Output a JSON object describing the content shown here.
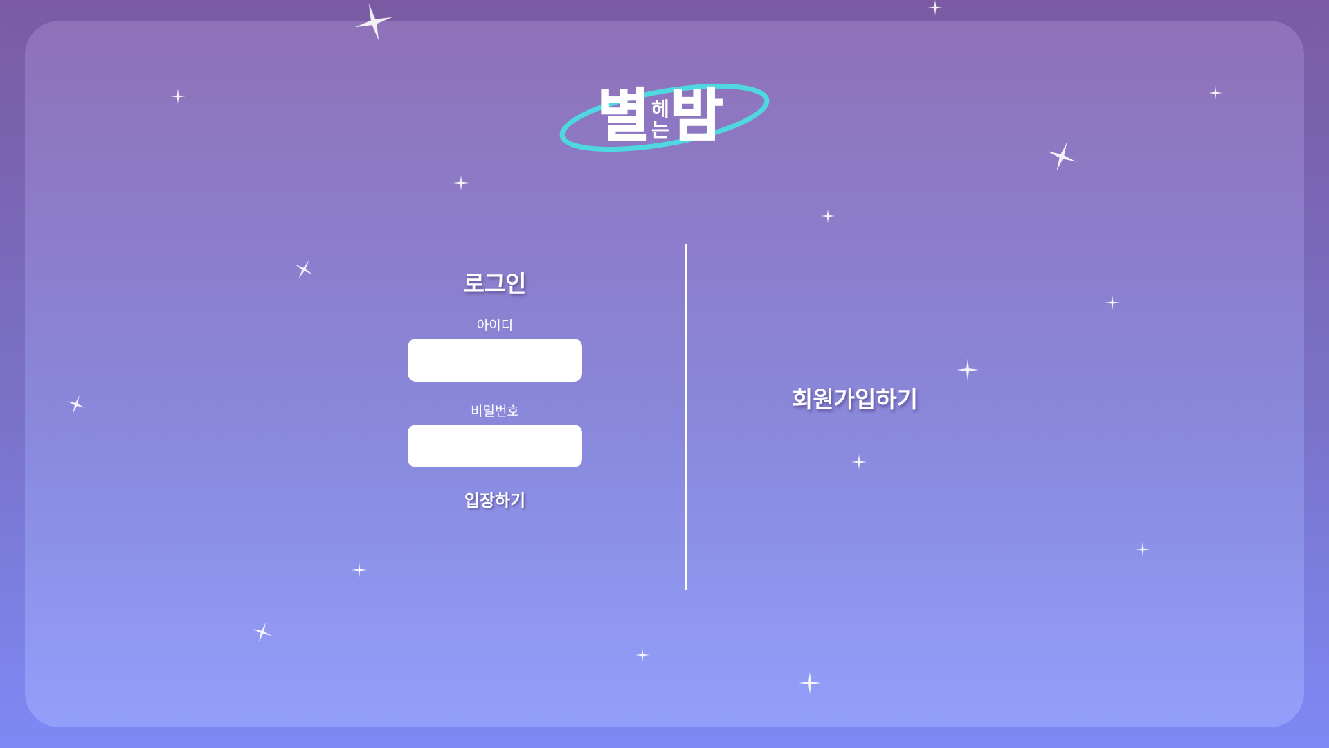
{
  "app": {
    "logo_icon": "byeol-heneun-bam-logo",
    "logo_text_main_1": "별",
    "logo_text_small_1": "헤",
    "logo_text_small_2": "는",
    "logo_text_main_2": "밤"
  },
  "login": {
    "title": "로그인",
    "id_label": "아이디",
    "id_value": "",
    "password_label": "비밀번호",
    "password_value": "",
    "submit_label": "입장하기"
  },
  "signup": {
    "label": "회원가입하기"
  },
  "colors": {
    "background_top": "#7a5ba3",
    "background_bottom": "#7e89f5",
    "logo_ring": "#4fd8e0",
    "text": "#ffffff"
  },
  "decoration": {
    "star_icon": "sparkle-star-icon"
  }
}
